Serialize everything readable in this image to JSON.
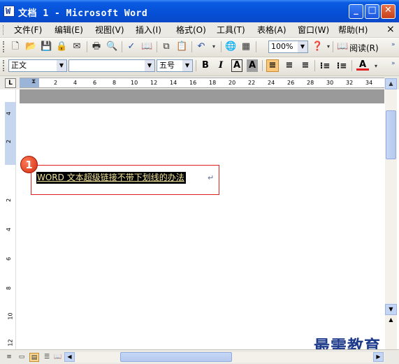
{
  "window": {
    "title": "文档 1 - Microsoft Word",
    "minimize": "_",
    "maximize": "□",
    "close": "✕"
  },
  "menu": {
    "items": [
      "文件(F)",
      "编辑(E)",
      "视图(V)",
      "插入(I)",
      "格式(O)",
      "工具(T)",
      "表格(A)",
      "窗口(W)",
      "帮助(H)"
    ],
    "close": "×"
  },
  "standard_toolbar": {
    "icons": [
      "new-icon",
      "open-icon",
      "save-icon",
      "permission-icon",
      "email-icon",
      "print-icon",
      "print-preview-icon",
      "spelling-icon",
      "research-icon",
      "copy-icon",
      "paste-icon",
      "undo-icon",
      "hyperlink-icon",
      "table-icon"
    ],
    "zoom": "100%",
    "reading_label": "阅读(R)"
  },
  "format_toolbar": {
    "style": "正文",
    "font": "",
    "size": "五号",
    "bold": "B",
    "italic": "I",
    "char_border": "A",
    "char_shading": "A",
    "font_color_label": "A",
    "font_color": "#e02020"
  },
  "ruler": {
    "corner": "L",
    "ticks": [
      "2",
      "4",
      "6",
      "8",
      "10",
      "12",
      "14",
      "16",
      "18",
      "20",
      "22",
      "24",
      "26",
      "28",
      "30",
      "32",
      "34"
    ],
    "vticks": [
      "4",
      "2",
      "2",
      "4",
      "6",
      "8",
      "10",
      "12"
    ]
  },
  "document": {
    "selected_text": "WORD 文本超级链接不带下划线的办法",
    "paragraph_mark": "↵",
    "callout_number": "1"
  },
  "watermark": "最需教育",
  "colors": {
    "title_bar": "#0550d6",
    "selection_bg": "#000000",
    "selection_text": "#f3e59b",
    "callout": "#d02d10",
    "highlight_box": "#e02020"
  }
}
